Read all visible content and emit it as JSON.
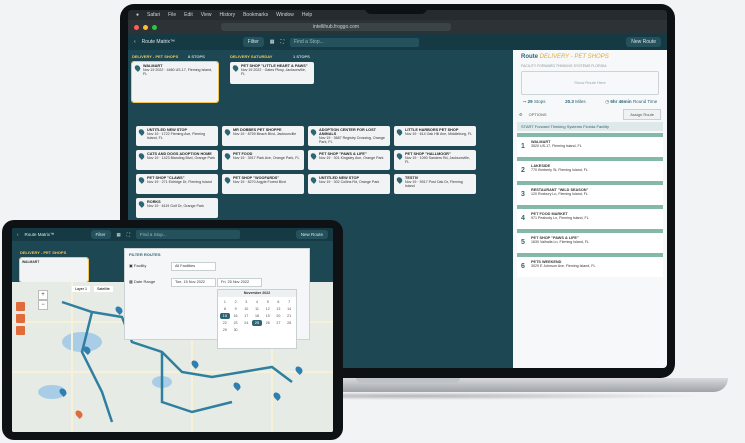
{
  "mac_menu": [
    "Safari",
    "File",
    "Edit",
    "View",
    "History",
    "Bookmarks",
    "Window",
    "Help"
  ],
  "url": "intellihub.froggo.com",
  "app": {
    "back": "‹",
    "logo": "Route Matrix™",
    "filter": "Filter",
    "search_placeholder": "Find a Stop...",
    "new_route": "New Route"
  },
  "columns": {
    "a": "DELIVERY - PET SHOPS",
    "a_count": "8 STOPS",
    "b": "DELIVERY SATURDAY",
    "b_count": "1 STOPS"
  },
  "cards": [
    {
      "title": "WALMART",
      "line": "Nov 19 2022 · 4460 US-17, Fleming Island, FL"
    },
    {
      "title": "PET SHOP \"LITTLE HEART & PAWS\"",
      "line": "Nov 19 2022 · Gates Pkwy, Jacksonville, FL"
    },
    {
      "title": "UNTITLED NEW STOP",
      "line": "Nov 19 · 1722 Fleming Ave, Fleming Island, FL"
    },
    {
      "title": "MR DOBBES PET SHOPPE",
      "line": "Nov 19 · 8759 Beach Blvd, Jacksonville"
    },
    {
      "title": "ADOPTION CENTER FOR LOST ANIMALS",
      "line": "Nov 19 · 3687 Registry Crossing, Orange Park, FL"
    },
    {
      "title": "LITTLE HARBORS PET SHOP",
      "line": "Nov 19 · 614 Oak Hill Ave, Middleburg, FL"
    },
    {
      "title": "CATS AND DOGS ADOPTION HOME",
      "line": "Nov 19 · 1423 Blanding Blvd, Orange Park"
    },
    {
      "title": "PET FOOD",
      "line": "Nov 19 · 3917 Park Ave, Orange Park, FL"
    },
    {
      "title": "PET SHOP \"PAWS & LIFE\"",
      "line": "Nov 19 · 301 Kingsley Ave, Orange Park"
    },
    {
      "title": "PET SHOP \"HALLMOOR\"",
      "line": "Nov 19 · 1090 Sanders Rd, Jacksonville, FL"
    },
    {
      "title": "PET SHOP \"CLAWS\"",
      "line": "Nov 19 · 271 Eldridge Dr, Fleming Island"
    },
    {
      "title": "PET SHOP \"WOOFARDS\"",
      "line": "Nov 19 · 8270 Argyle Forest Blvd"
    },
    {
      "title": "UNTITLED NEW STOP",
      "line": "Nov 19 · 302 Collins Rd, Orange Park"
    },
    {
      "title": "TESTIV",
      "line": "Nov 19 · 5917 Post Oak Dr, Fleming Island"
    },
    {
      "title": "RORKS",
      "line": "Nov 19 · 6119 Golf Dr, Orange Park"
    }
  ],
  "panel": {
    "title_prefix": "Route",
    "title_em": "DELIVERY - PET SHOPS",
    "subtitle": "FACILITY FORWARD THINKING SYSTEMS FLORIDA",
    "select_placeholder": "Show Route Here",
    "stops": "29",
    "stops_label": "Stops",
    "miles": "20.3",
    "miles_label": "Miles",
    "time": "6hr 46min",
    "time_label": "Round Time",
    "options": "OPTIONS",
    "assign": "Assign Route",
    "start": "START Forward Thinking Systems Florida Facility"
  },
  "route_stops": [
    {
      "num": "1",
      "title": "WALMART",
      "addr": "3520 US-17, Fleming Island, FL"
    },
    {
      "num": "2",
      "title": "LAKESIDE",
      "addr": "770 Kimberly St, Fleming Island, FL"
    },
    {
      "num": "3",
      "title": "RESTAURANT \"WILD SEASON\"",
      "addr": "120 Roxbury Ln, Fleming Island, FL"
    },
    {
      "num": "4",
      "title": "PET FOOD MARKET",
      "addr": "971 Peabody Ln, Fleming Island, FL"
    },
    {
      "num": "5",
      "title": "PET SHOP \"PAWS & LIFE\"",
      "addr": "1630 Valhalla Ln, Fleming Island, FL"
    },
    {
      "num": "6",
      "title": "PETS WEEKEND",
      "addr": "3029 E Johnson Ave, Fleming Island, FL"
    }
  ],
  "tablet": {
    "logo": "Route Matrix™",
    "filter": "Filter",
    "search": "Find a Stop...",
    "new_route": "New Route",
    "col": "DELIVERY - PET SHOPS",
    "card": "WALMART",
    "popover_title": "FILTER ROUTES",
    "facility": "Facility",
    "facility_value": "All Facilities",
    "date_range": "Date Range",
    "date_from": "Tue, 15 Nov 2022",
    "date_to": "Fri, 25 Nov 2022",
    "month": "November 2022",
    "days": [
      "1",
      "2",
      "3",
      "4",
      "5",
      "6",
      "7",
      "8",
      "9",
      "10",
      "11",
      "12",
      "13",
      "14",
      "15",
      "16",
      "17",
      "18",
      "19",
      "20",
      "21",
      "22",
      "23",
      "24",
      "25",
      "26",
      "27",
      "28",
      "29",
      "30"
    ],
    "layer_tab": "Layer 1",
    "layer_tab2": "Satellite",
    "zoom_in": "+",
    "zoom_out": "−"
  }
}
